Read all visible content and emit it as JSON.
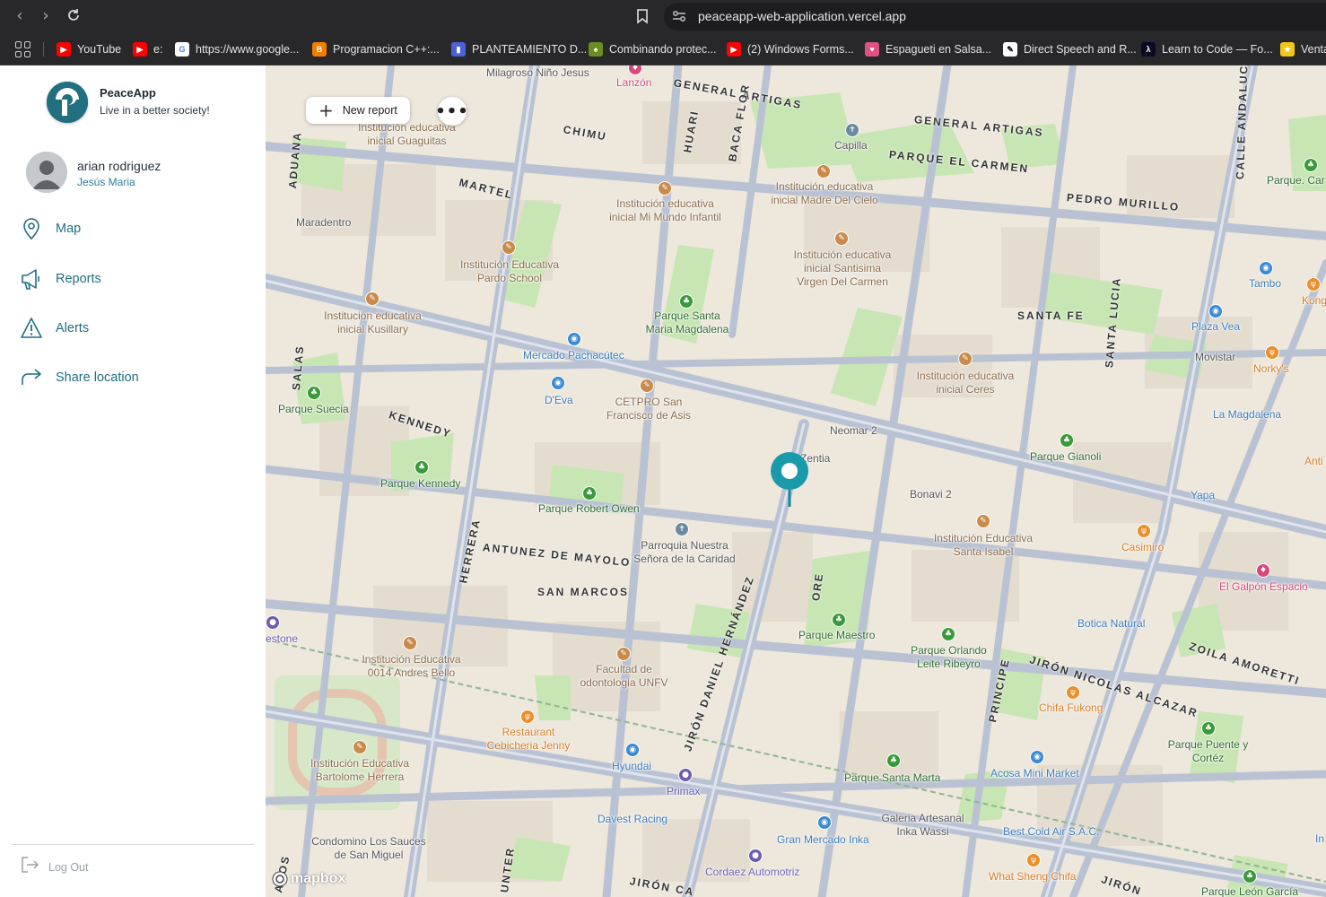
{
  "browser": {
    "url": "peaceapp-web-application.vercel.app",
    "bookmarks": [
      {
        "label": "YouTube",
        "icon": "youtube-icon",
        "color": "#ff0000"
      },
      {
        "label": "e:",
        "icon": "youtube-icon",
        "color": "#ff0000"
      },
      {
        "label": "https://www.google...",
        "icon": "google-icon",
        "color": "#4285f4"
      },
      {
        "label": "Programacion C++:...",
        "icon": "blogger-icon",
        "color": "#f57d00"
      },
      {
        "label": "PLANTEAMIENTO D...",
        "icon": "doc-icon",
        "color": "#4a62d8"
      },
      {
        "label": "Combinando protec...",
        "icon": "leaf-icon",
        "color": "#6b8e23"
      },
      {
        "label": "(2) Windows Forms...",
        "icon": "youtube-icon",
        "color": "#ff0000"
      },
      {
        "label": "Espagueti en Salsa...",
        "icon": "pin-icon",
        "color": "#e05080"
      },
      {
        "label": "Direct Speech and R...",
        "icon": "school-icon",
        "color": "#ffffff"
      },
      {
        "label": "Learn to Code — Fo...",
        "icon": "freecodecamp-icon",
        "color": "#0a0a23"
      },
      {
        "label": "Venta",
        "icon": "star-icon",
        "color": "#f5c518"
      }
    ]
  },
  "app": {
    "name": "PeaceApp",
    "tagline": "Live in a better society!",
    "accent": "#1f6e84"
  },
  "user": {
    "name": "arian rodriguez",
    "location": "Jesús Maria"
  },
  "nav": {
    "items": [
      {
        "label": "Map",
        "icon": "location-pin-icon"
      },
      {
        "label": "Reports",
        "icon": "megaphone-icon"
      },
      {
        "label": "Alerts",
        "icon": "warning-icon"
      },
      {
        "label": "Share location",
        "icon": "share-icon"
      }
    ],
    "logout": "Log Out"
  },
  "map": {
    "new_report_label": "New report",
    "attribution": "mapbox",
    "streets": [
      "GENERAL ARTIGAS",
      "GENERAL ARTIGAS",
      "PARQUE EL CARMEN",
      "CHIMU",
      "MARTEL",
      "HUARI",
      "BACA FLOR",
      "PEDRO MURILLO",
      "SANTA FE",
      "SANTA LUCIA",
      "CALLE ANDALUCI",
      "ADUANA",
      "SALAS",
      "KENNEDY",
      "HERRERA",
      "ANTUNEZ DE MAYOLO",
      "SAN MARCOS",
      "JIRÓN DANIEL HERNÁNDEZ",
      "ORE",
      "PRINCIPE",
      "JIRÓN NICOLAS ALCAZAR",
      "ZOILA AMORETTI",
      "JIRÓN CA",
      "UNTER",
      "JIRÓN",
      "ADOS"
    ],
    "places": [
      "Milagroso Niño Jesus",
      "Lanzón",
      "Institución educativa inicial Guaguitas",
      "Capilla",
      "Institución educativa inicial Madre Del Cielo",
      "Parque. Car",
      "Maradentro",
      "Institución educativa inicial Mi Mundo Infantil",
      "Institución Educativa Pardo School",
      "Institución educativa inicial Santisima Virgen Del Carmen",
      "Tambo",
      "Kong",
      "Parque Santa Maria Magdalena",
      "Plaza Vea",
      "Institución educativa inicial Kusillary",
      "Mercado Pachacútec",
      "Movistar",
      "Norky's",
      "Institución educativa inicial Ceres",
      "D'Eva",
      "CETPRO San Francisco de Asis",
      "La Magdalena",
      "Parque Suecia",
      "Neomar 2",
      "Zentia",
      "Parque Gianoli",
      "Anti",
      "Parque Kennedy",
      "Bonavi 2",
      "Yapa",
      "Parque Robert Owen",
      "Parroquia Nuestra Señora de la Caridad",
      "Institución Educativa Santa Isabel",
      "Casimiro",
      "El Galpón Espacio",
      "Parque Maestro",
      "Botica Natural",
      "estone",
      "Institución Educativa 0014 Andres Bello",
      "Facultad de odontologia UNFV",
      "Parque Orlando Leite Ribeyro",
      "Chifa Fukong",
      "Restaurant Cebicheria Jenny",
      "Parque Puente y Cortéz",
      "Institución Educativa Bartolome Herrera",
      "Hyundai",
      "Primax",
      "Parque Santa Marta",
      "Acosa Mini Market",
      "Davest Racing",
      "Galeria Artesanal Inka Wassi",
      "Gran Mercado Inka",
      "Best Cold Air S.A.C.",
      "In",
      "Condomino Los Sauces de San Miguel",
      "Cordaez Automotriz",
      "What Sheng Chifa",
      "Parque León García"
    ]
  }
}
